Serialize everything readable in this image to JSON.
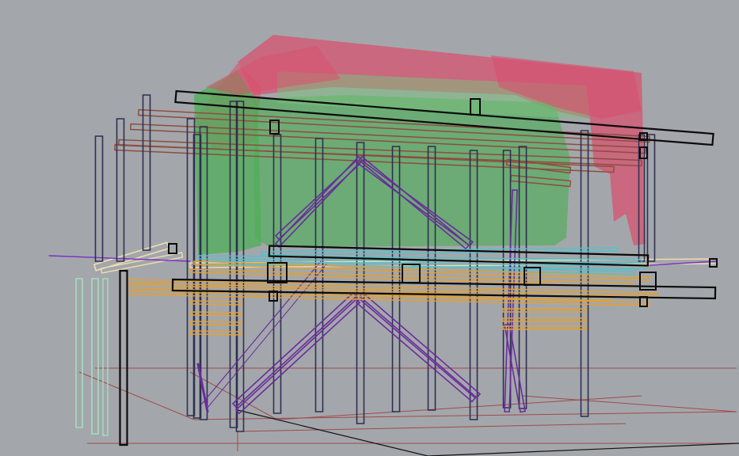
{
  "viewport": {
    "background": "#a3a7ab",
    "grid_color": "#a04a4a",
    "axis_color": "#111111"
  },
  "point_cloud": {
    "colors": {
      "red": "#d8506e",
      "green": "#4fae58",
      "pale_green": "#7cc27d"
    }
  },
  "model": {
    "colors": {
      "column": "#2e3050",
      "bracing": "#6a2c9c",
      "beam_black": "#0a0a0a",
      "beam_brown": "#8e4d3e",
      "beam_orange": "#e8a02a",
      "beam_cyan": "#4ec3cc",
      "beam_cream": "#f0ddb0",
      "beam_mint": "#a8dcc0",
      "axis_purple": "#7a2fc8"
    }
  }
}
